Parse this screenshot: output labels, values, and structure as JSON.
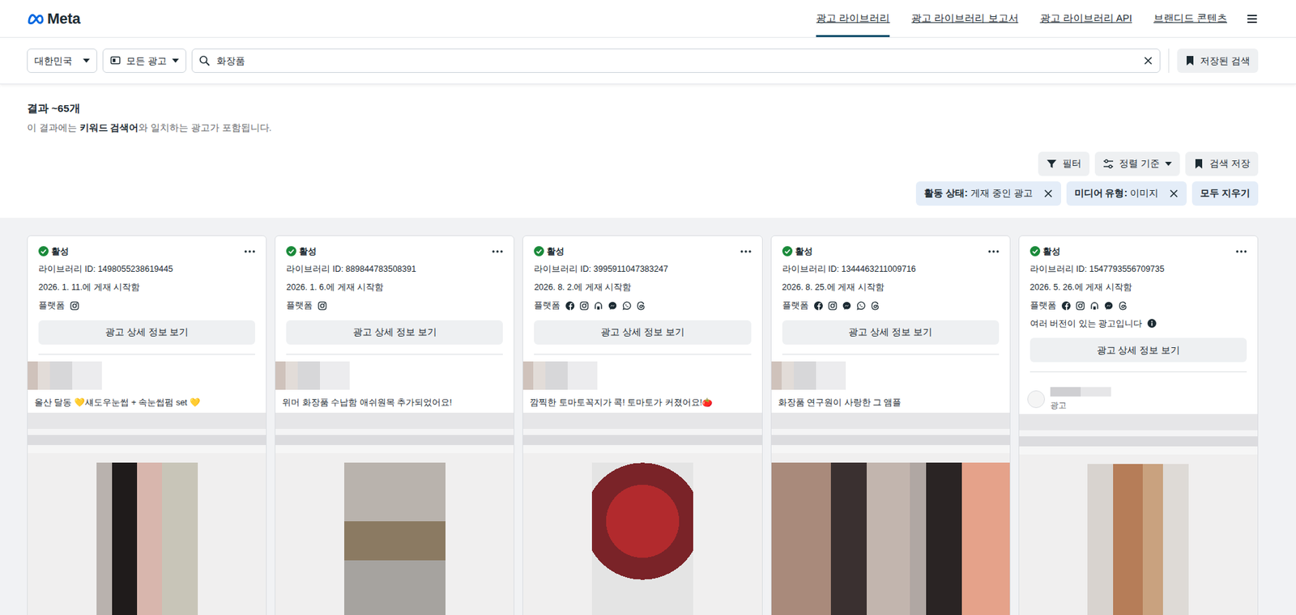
{
  "brand": {
    "name": "Meta"
  },
  "nav": [
    {
      "label": "광고 라이브러리",
      "selected": true
    },
    {
      "label": "광고 라이브러리 보고서",
      "selected": false
    },
    {
      "label": "광고 라이브러리 API",
      "selected": false
    },
    {
      "label": "브랜디드 콘텐츠",
      "selected": false
    }
  ],
  "search_bar": {
    "country": "대한민국",
    "ad_type": "모든 광고",
    "query": "화장품",
    "saved": "저장된 검색"
  },
  "results": {
    "count": "결과 ~65개",
    "note": [
      {
        "text": "이 결과에는 ",
        "bold": false
      },
      {
        "text": "키워드 검색어",
        "bold": true
      },
      {
        "text": "와 일치하는 광고가 포함됩니다.",
        "bold": false
      }
    ]
  },
  "toolbar": [
    {
      "label": "필터",
      "kind": "filter"
    },
    {
      "label": "정렬 기준",
      "kind": "sort"
    },
    {
      "label": "검색 저장",
      "kind": "bookmark"
    }
  ],
  "chips": [
    {
      "key": "활동 상태:",
      "value": "게재 중인 광고"
    },
    {
      "key": "미디어 유형:",
      "value": "이미지"
    }
  ],
  "clear_all": "모두 지우기",
  "ads": [
    {
      "status": "활성",
      "library_id": "라이브러리 ID: 1498055238619445",
      "started": "2026. 1. 11.에 게재 시작함",
      "platform_label": "플랫폼",
      "platforms": [
        {
          "kind": "instagram"
        }
      ],
      "details_button": "광고 상세 정보 보기",
      "text": "올산 달동 💛섀도우눈썹 + 속눈썹펌 set 💛"
    },
    {
      "status": "활성",
      "library_id": "라이브러리 ID: 889844783508391",
      "started": "2026. 1. 6.에 게재 시작함",
      "platform_label": "플랫폼",
      "platforms": [
        {
          "kind": "instagram"
        }
      ],
      "details_button": "광고 상세 정보 보기",
      "text": "위머 화장품 수납함 애쉬원목 추가되었어요!"
    },
    {
      "status": "활성",
      "library_id": "라이브러리 ID: 3995911047383247",
      "started": "2026. 8. 2.에 게재 시작함",
      "platform_label": "플랫폼",
      "platforms": [
        {
          "kind": "facebook"
        },
        {
          "kind": "instagram"
        },
        {
          "kind": "audience"
        },
        {
          "kind": "messenger"
        },
        {
          "kind": "whatsapp"
        },
        {
          "kind": "threads"
        }
      ],
      "details_button": "광고 상세 정보 보기",
      "text": "깜찍한 토마토꼭지가 콕! 토마토가 커졌어요!🍅"
    },
    {
      "status": "활성",
      "library_id": "라이브러리 ID: 1344463211009716",
      "started": "2026. 8. 25.에 게재 시작함",
      "platform_label": "플랫폼",
      "platforms": [
        {
          "kind": "facebook"
        },
        {
          "kind": "instagram"
        },
        {
          "kind": "messenger"
        },
        {
          "kind": "whatsapp"
        },
        {
          "kind": "threads"
        }
      ],
      "details_button": "광고 상세 정보 보기",
      "text": "화장품 연구원이 사랑한 그 앰플"
    },
    {
      "status": "활성",
      "library_id": "라이브러리 ID: 1547793556709735",
      "started": "2026. 5. 26.에 게재 시작함",
      "platform_label": "플랫폼",
      "platforms": [
        {
          "kind": "facebook"
        },
        {
          "kind": "instagram"
        },
        {
          "kind": "audience"
        },
        {
          "kind": "messenger"
        },
        {
          "kind": "threads"
        }
      ],
      "versions_note": "여러 버전이 있는 광고입니다",
      "details_button": "광고 상세 정보 보기",
      "sponsor_label": "광고"
    }
  ]
}
